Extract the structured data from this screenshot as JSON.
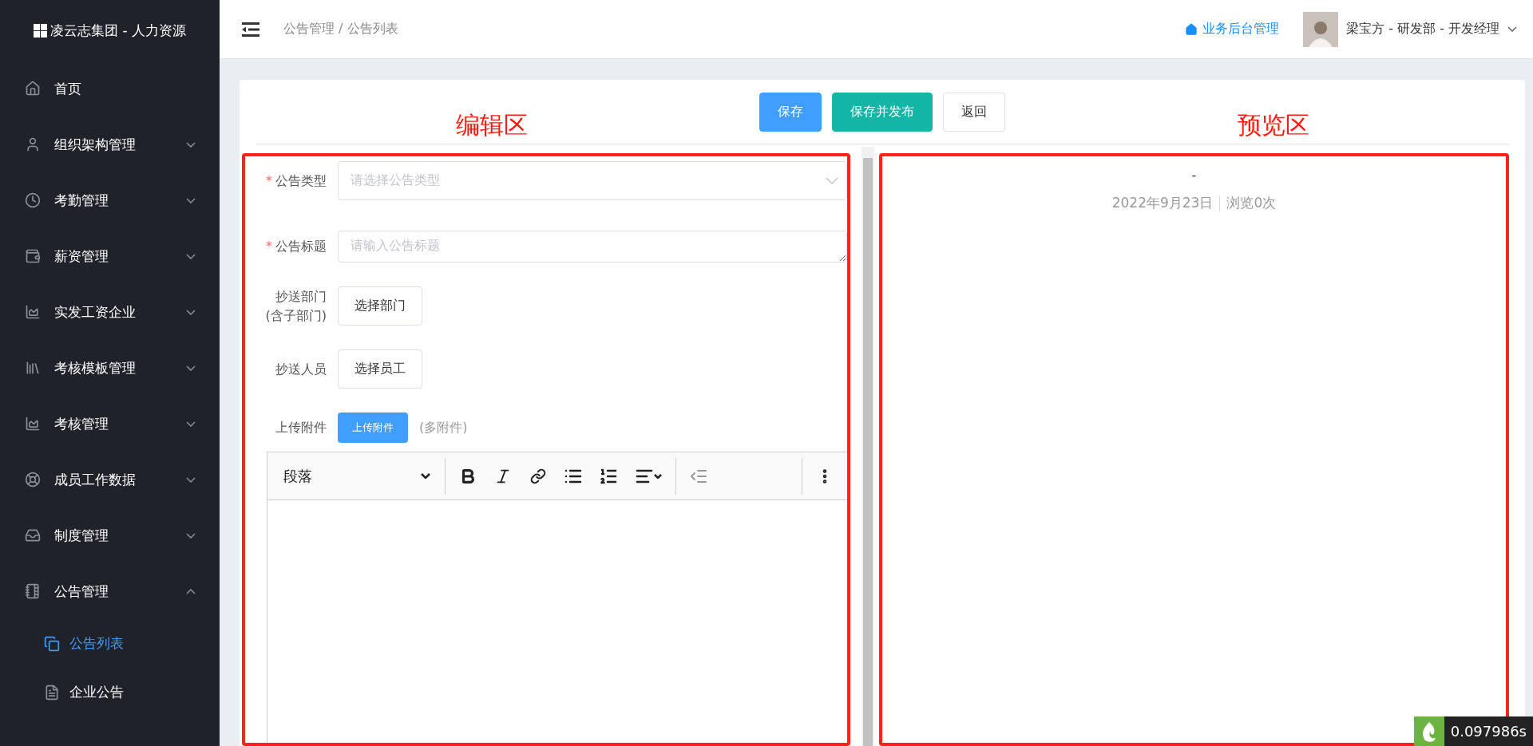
{
  "sidebar": {
    "logo": "凌云志集团 - 人力资源",
    "items": [
      {
        "kind": "link",
        "label": "首页"
      },
      {
        "kind": "group",
        "label": "组织架构管理",
        "expanded": false
      },
      {
        "kind": "group",
        "label": "考勤管理",
        "expanded": false
      },
      {
        "kind": "group",
        "label": "薪资管理",
        "expanded": false
      },
      {
        "kind": "group",
        "label": "实发工资企业",
        "expanded": false
      },
      {
        "kind": "group",
        "label": "考核模板管理",
        "expanded": false
      },
      {
        "kind": "group",
        "label": "考核管理",
        "expanded": false
      },
      {
        "kind": "group",
        "label": "成员工作数据",
        "expanded": false
      },
      {
        "kind": "group",
        "label": "制度管理",
        "expanded": false
      },
      {
        "kind": "group",
        "label": "公告管理",
        "expanded": true,
        "children": [
          {
            "label": "公告列表",
            "selected": true
          },
          {
            "label": "企业公告",
            "selected": false
          }
        ]
      }
    ]
  },
  "header": {
    "breadcrumb": "公告管理 / 公告列表",
    "admin_link": "业务后台管理",
    "user": "梁宝方 - 研发部 - 开发经理"
  },
  "actions": [
    {
      "kind": "primary",
      "label": "保存"
    },
    {
      "kind": "success",
      "label": "保存并发布"
    },
    {
      "kind": "default",
      "label": "返回"
    }
  ],
  "annotations": {
    "edit": "编辑区",
    "preview": "预览区"
  },
  "form": [
    {
      "kind": "select",
      "required_mark": "*",
      "label": "公告类型",
      "placeholder": "请选择公告类型"
    },
    {
      "kind": "textarea",
      "required_mark": "*",
      "label": "公告标题",
      "placeholder": "请输入公告标题"
    },
    {
      "kind": "button",
      "label": "抄送部门",
      "label_note": "(含子部门)",
      "button": "选择部门"
    },
    {
      "kind": "button",
      "label": "抄送人员",
      "button": "选择员工"
    },
    {
      "kind": "upload",
      "label": "上传附件",
      "button": "上传附件",
      "hint": "(多附件)"
    }
  ],
  "editor": {
    "block_format": "段落"
  },
  "preview": {
    "title": "-",
    "date": "2022年9月23日",
    "views": "浏览0次"
  },
  "debug_badge": {
    "time": "0.097986s"
  }
}
